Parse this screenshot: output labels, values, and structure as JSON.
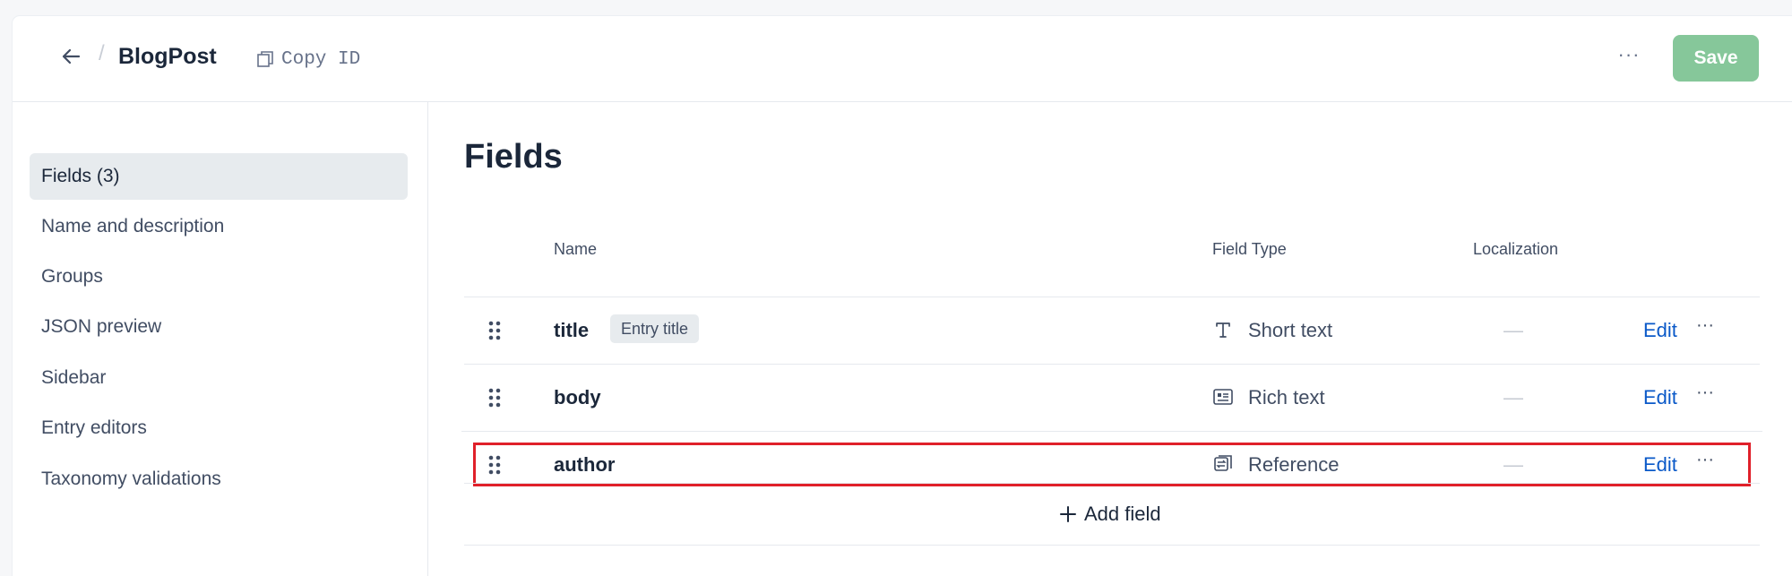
{
  "header": {
    "back_icon": "arrow-left-icon",
    "breadcrumb_separator": "/",
    "title": "BlogPost",
    "copy_id_label": "Copy ID",
    "copy_icon": "copy-icon",
    "more_label": "···",
    "save_label": "Save",
    "save_color": "#86c79a"
  },
  "sidebar": {
    "items": [
      {
        "label": "Fields (3)",
        "active": true
      },
      {
        "label": "Name and description"
      },
      {
        "label": "Groups"
      },
      {
        "label": "JSON preview"
      },
      {
        "label": "Sidebar"
      },
      {
        "label": "Entry editors"
      },
      {
        "label": "Taxonomy validations"
      }
    ]
  },
  "main": {
    "title": "Fields",
    "columns": {
      "name": "Name",
      "field_type": "Field Type",
      "localization": "Localization"
    },
    "fields": [
      {
        "name": "title",
        "badge": "Entry title",
        "type": "Short text",
        "type_icon": "text-type-icon",
        "localization": "—",
        "edit": "Edit",
        "more": "···"
      },
      {
        "name": "body",
        "badge": "",
        "type": "Rich text",
        "type_icon": "rich-text-icon",
        "localization": "—",
        "edit": "Edit",
        "more": "···"
      },
      {
        "name": "author",
        "badge": "",
        "type": "Reference",
        "type_icon": "reference-icon",
        "localization": "—",
        "edit": "Edit",
        "more": "···",
        "highlighted": true
      }
    ],
    "add_field_label": "Add field",
    "add_icon": "plus-icon"
  },
  "colors": {
    "link": "#0a59c8",
    "highlight_outline": "#e0202a",
    "active_bg": "#e7ebee"
  }
}
